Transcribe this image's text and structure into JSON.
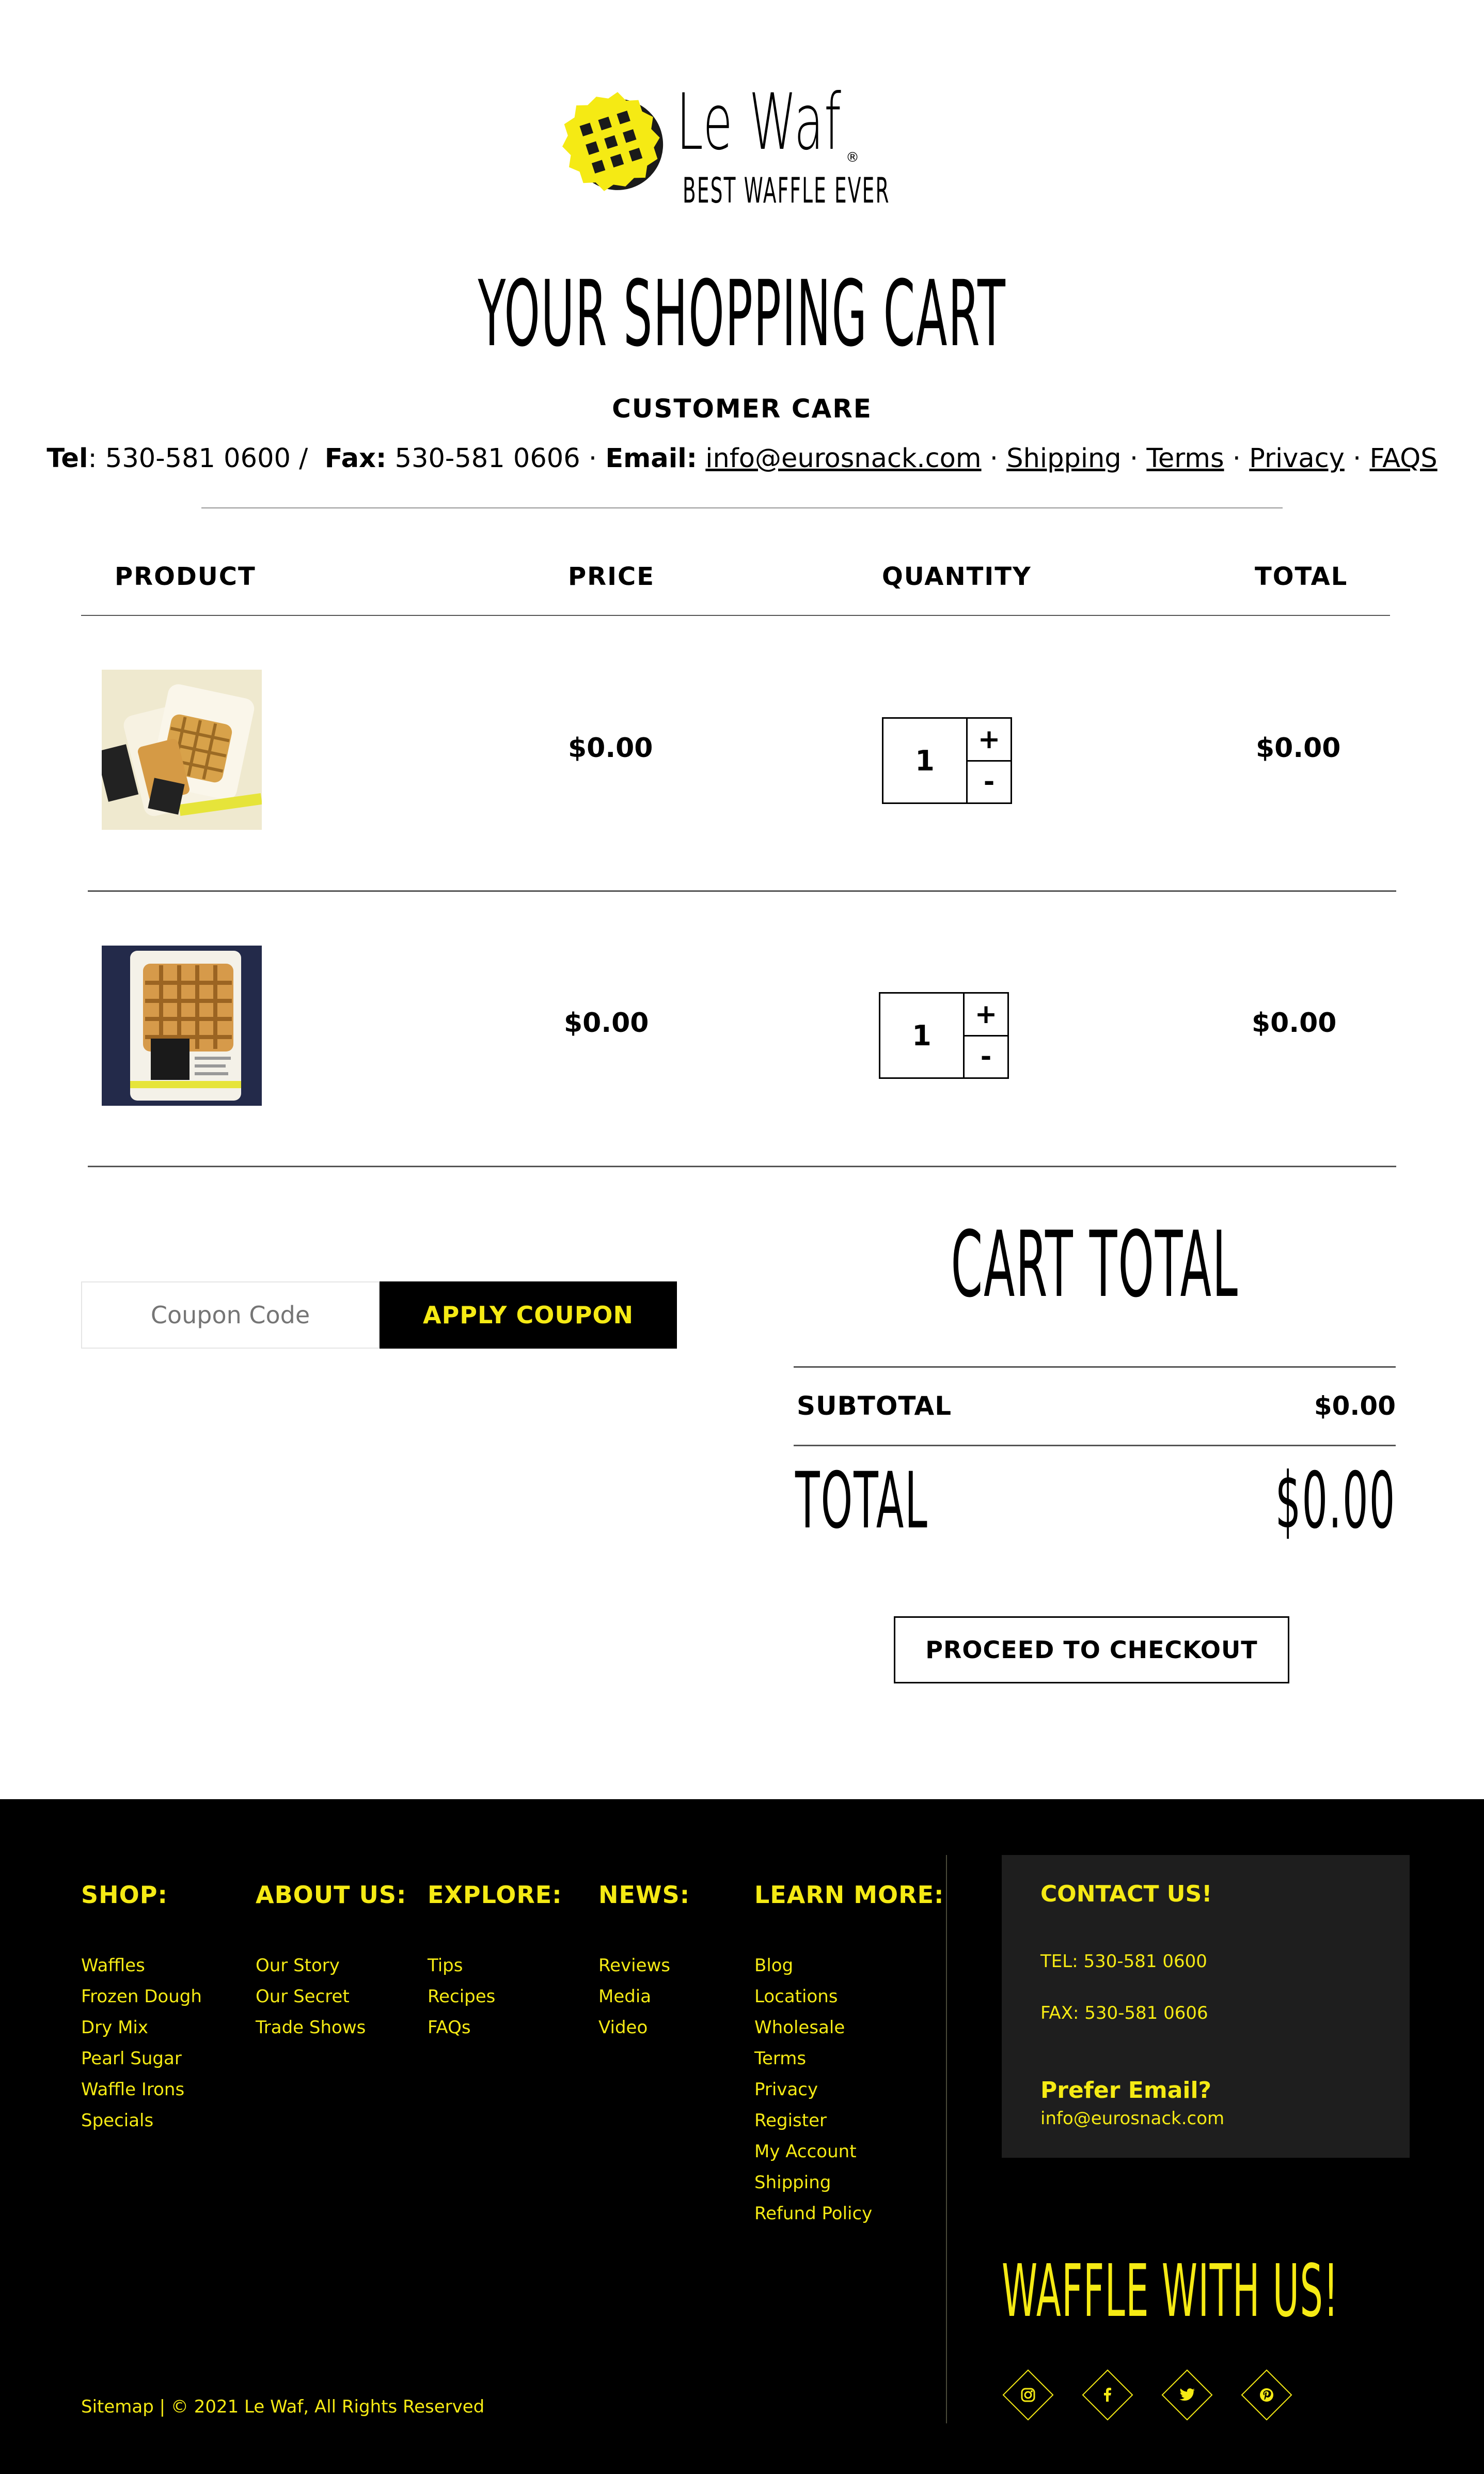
{
  "brand": {
    "name": "Le Waf",
    "tagline": "BEST WAFFLE EVER",
    "registered_mark": "®",
    "logo_colors": {
      "primary": "#f5ea14",
      "dark": "#1a1a1a"
    }
  },
  "page_title": "YOUR SHOPPING CART",
  "customer_care": {
    "title": "CUSTOMER CARE",
    "tel_label": "Tel",
    "tel": "530-581 0600",
    "fax_label": "Fax:",
    "fax": "530-581 0606",
    "email_label": "Email:",
    "email": "info@eurosnack.com",
    "links": [
      "Shipping",
      "Terms",
      "Privacy",
      "FAQS"
    ]
  },
  "cart": {
    "headers": {
      "product": "PRODUCT",
      "price": "PRICE",
      "quantity": "QUANTITY",
      "total": "TOTAL"
    },
    "items": [
      {
        "price": "$0.00",
        "quantity": "1",
        "total": "$0.00",
        "plus": "+",
        "minus": "-",
        "image": "waffle-package-light"
      },
      {
        "price": "$0.00",
        "quantity": "1",
        "total": "$0.00",
        "plus": "+",
        "minus": "-",
        "image": "waffle-package-dark"
      }
    ]
  },
  "coupon": {
    "placeholder": "Coupon Code",
    "button": "APPLY COUPON"
  },
  "cart_total": {
    "title": "CART TOTAL",
    "subtotal_label": "SUBTOTAL",
    "subtotal": "$0.00",
    "total_label": "TOTAL",
    "total": "$0.00",
    "checkout": "PROCEED TO CHECKOUT"
  },
  "footer": {
    "columns": [
      {
        "title": "SHOP:",
        "links": [
          "Waffles",
          "Frozen Dough",
          "Dry Mix",
          "Pearl Sugar",
          "Waffle Irons",
          "Specials"
        ]
      },
      {
        "title": "ABOUT US:",
        "links": [
          "Our Story",
          "Our Secret",
          "Trade Shows"
        ]
      },
      {
        "title": "EXPLORE:",
        "links": [
          "Tips",
          "Recipes",
          "FAQs"
        ]
      },
      {
        "title": "NEWS:",
        "links": [
          "Reviews",
          "Media",
          "Video"
        ]
      },
      {
        "title": "LEARN MORE:",
        "links": [
          "Blog",
          "Locations",
          "Wholesale",
          "Terms",
          "Privacy",
          "Register",
          "My Account",
          "Shipping",
          "Refund Policy"
        ]
      }
    ],
    "contact": {
      "title": "CONTACT US!",
      "tel": "TEL: 530-581 0600",
      "fax": "FAX: 530-581 0606",
      "prefer_email": "Prefer Email?",
      "email": "info@eurosnack.com"
    },
    "slogan": "WAFFLE WITH US!",
    "social": [
      "instagram-icon",
      "facebook-icon",
      "twitter-icon",
      "pinterest-icon"
    ],
    "bottom_text": "Sitemap  |  © 2021 Le Waf, All Rights Reserved",
    "accent_color": "#f5ea14"
  }
}
